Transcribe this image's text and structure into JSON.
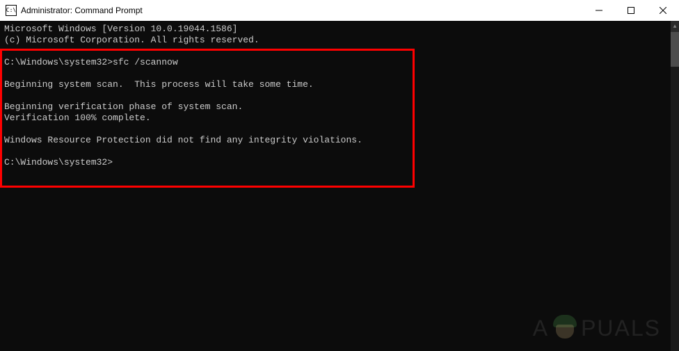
{
  "titlebar": {
    "icon_label": "C:\\",
    "title": "Administrator: Command Prompt"
  },
  "console": {
    "lines": [
      "Microsoft Windows [Version 10.0.19044.1586]",
      "(c) Microsoft Corporation. All rights reserved.",
      "",
      "C:\\Windows\\system32>sfc /scannow",
      "",
      "Beginning system scan.  This process will take some time.",
      "",
      "Beginning verification phase of system scan.",
      "Verification 100% complete.",
      "",
      "Windows Resource Protection did not find any integrity violations.",
      "",
      "C:\\Windows\\system32>"
    ]
  },
  "watermark": {
    "left": "A",
    "right": "PUALS"
  }
}
